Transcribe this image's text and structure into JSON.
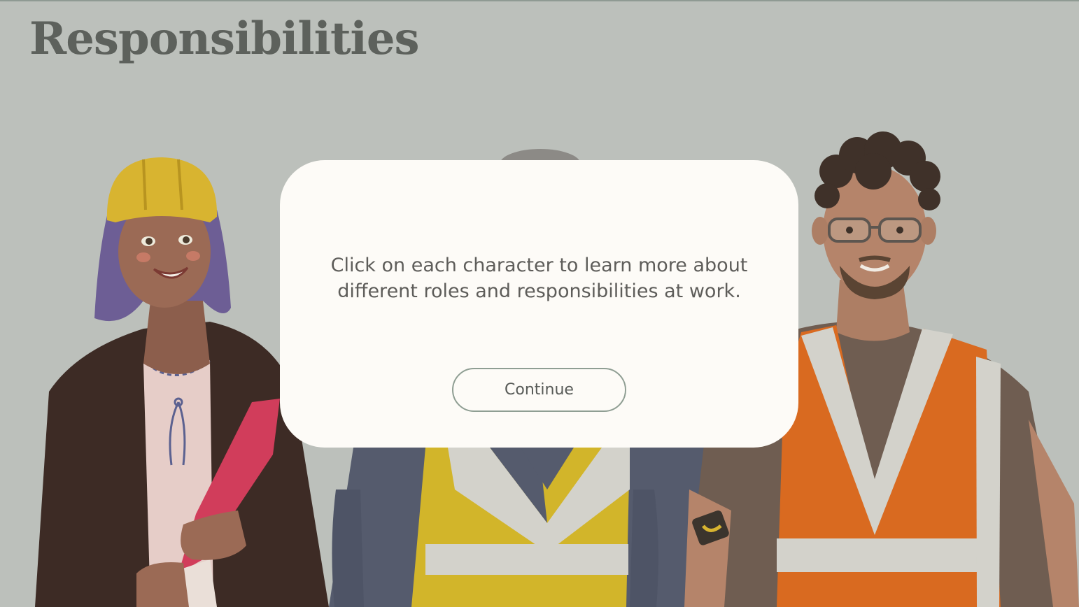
{
  "header": {
    "title": "Responsibilities"
  },
  "modal": {
    "message": "Click on each character to learn more about different roles and responsibilities at work.",
    "continue_label": "Continue"
  },
  "characters": [
    {
      "name": "woman-with-hard-hat-and-rolled-plans"
    },
    {
      "name": "worker-in-yellow-safety-vest"
    },
    {
      "name": "man-in-orange-safety-vest-with-glasses"
    }
  ],
  "colors": {
    "background": "#bcc0bb",
    "title": "#5d615c",
    "modal_background": "#fdfbf7",
    "button_border": "#8f9e93",
    "hard_hat_yellow": "#d8b430",
    "vest_yellow": "#d2b52a",
    "vest_orange": "#d96a20",
    "reflective_stripe": "#d3d2cb"
  }
}
